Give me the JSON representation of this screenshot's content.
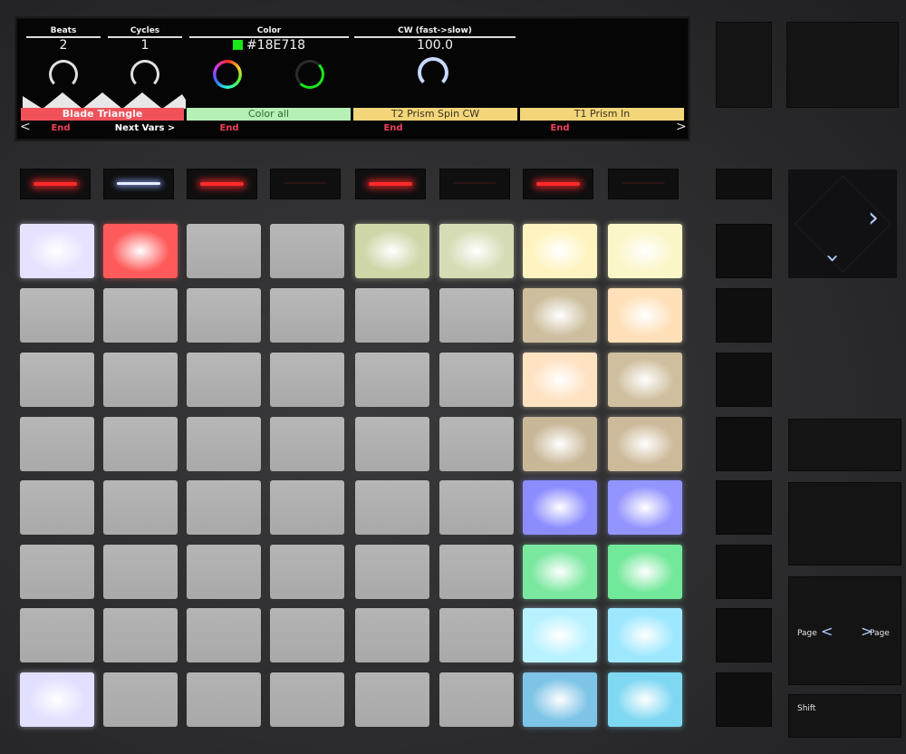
{
  "display": {
    "params": [
      {
        "name": "Beats",
        "value": "2"
      },
      {
        "name": "Cycles",
        "value": "1"
      },
      {
        "name": "Color",
        "value": "#18E718",
        "swatch_color": "#18E718"
      },
      {
        "name": "CW (fast->slow)",
        "value": "100.0"
      }
    ],
    "slots": [
      {
        "label": "Blade Triangle",
        "sub": "End"
      },
      {
        "label": "Color all",
        "sub": "End"
      },
      {
        "label": "T2 Prism Spin CW",
        "sub": "End"
      },
      {
        "label": "T1 Prism In",
        "sub": "End"
      }
    ],
    "next_vars": "Next Vars >",
    "prev_arrow": "<",
    "next_arrow": ">"
  },
  "upper_buttons": [
    {
      "led": "red"
    },
    {
      "led": "blue"
    },
    {
      "led": "red"
    },
    {
      "led": "off"
    },
    {
      "led": "red"
    },
    {
      "led": "off"
    },
    {
      "led": "red"
    },
    {
      "led": "off"
    }
  ],
  "pad_colors": [
    [
      "#e6e2ff",
      "#ff5a5a",
      "#b9b9b9",
      "#b7b7b7",
      "#cfd6a8",
      "#d6ddb6",
      "#fff4c0",
      "#fbf6c8"
    ],
    [
      "#b9b9b9",
      "#b9b9b9",
      "#b9b9b9",
      "#b9b9b9",
      "#b9b9b9",
      "#b9b9b9",
      "#cdbf9e",
      "#ffe0b8"
    ],
    [
      "#b8b8b8",
      "#b8b8b8",
      "#b8b8b8",
      "#b8b8b8",
      "#b8b8b8",
      "#b8b8b8",
      "#ffe2c2",
      "#cfbf9e"
    ],
    [
      "#b7b7b7",
      "#b7b7b7",
      "#b7b7b7",
      "#b7b7b7",
      "#b7b7b7",
      "#b7b7b7",
      "#c9b898",
      "#cdba9a"
    ],
    [
      "#b6b6b6",
      "#b6b6b6",
      "#b6b6b6",
      "#b6b6b6",
      "#b6b6b6",
      "#b6b6b6",
      "#8c8cff",
      "#9494ff"
    ],
    [
      "#b5b5b5",
      "#b5b5b5",
      "#b5b5b5",
      "#b5b5b5",
      "#b5b5b5",
      "#b5b5b5",
      "#7be8a0",
      "#72e89a"
    ],
    [
      "#b4b4b4",
      "#b4b4b4",
      "#b4b4b4",
      "#b4b4b4",
      "#b4b4b4",
      "#b4b4b4",
      "#b9f2ff",
      "#9ee8ff"
    ],
    [
      "#e2e0ff",
      "#b3b3b3",
      "#b3b3b3",
      "#b3b3b3",
      "#b3b3b3",
      "#b3b3b3",
      "#7ec4e6",
      "#7fd8f2"
    ]
  ],
  "side_labels": {
    "page_left": "Page",
    "page_right": "Page",
    "shift": "Shift",
    "chev_left": "<",
    "chev_right": ">"
  }
}
